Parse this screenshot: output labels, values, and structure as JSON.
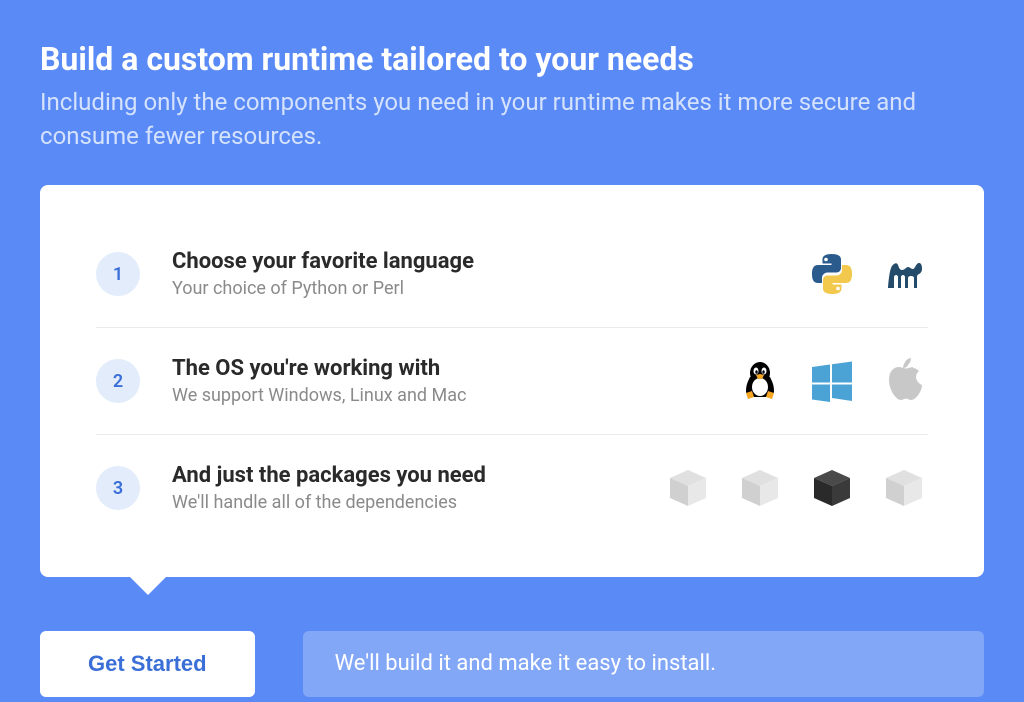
{
  "header": {
    "title": "Build a custom runtime tailored to your needs",
    "subtitle": "Including only the components you need in your runtime makes it more secure and consume fewer resources."
  },
  "steps": [
    {
      "number": "1",
      "title": "Choose your favorite language",
      "subtitle": "Your choice of Python or Perl"
    },
    {
      "number": "2",
      "title": "The OS you're working with",
      "subtitle": "We support Windows, Linux and Mac"
    },
    {
      "number": "3",
      "title": "And just the packages you need",
      "subtitle": "We'll handle all of the dependencies"
    }
  ],
  "footer": {
    "primary_label": "Get Started",
    "secondary_label": "We'll build it and make it easy to install."
  },
  "colors": {
    "background": "#5a8af5",
    "accent": "#3b6fd8",
    "text_dark": "#2a2a2a",
    "text_muted": "#8a8a8a"
  }
}
